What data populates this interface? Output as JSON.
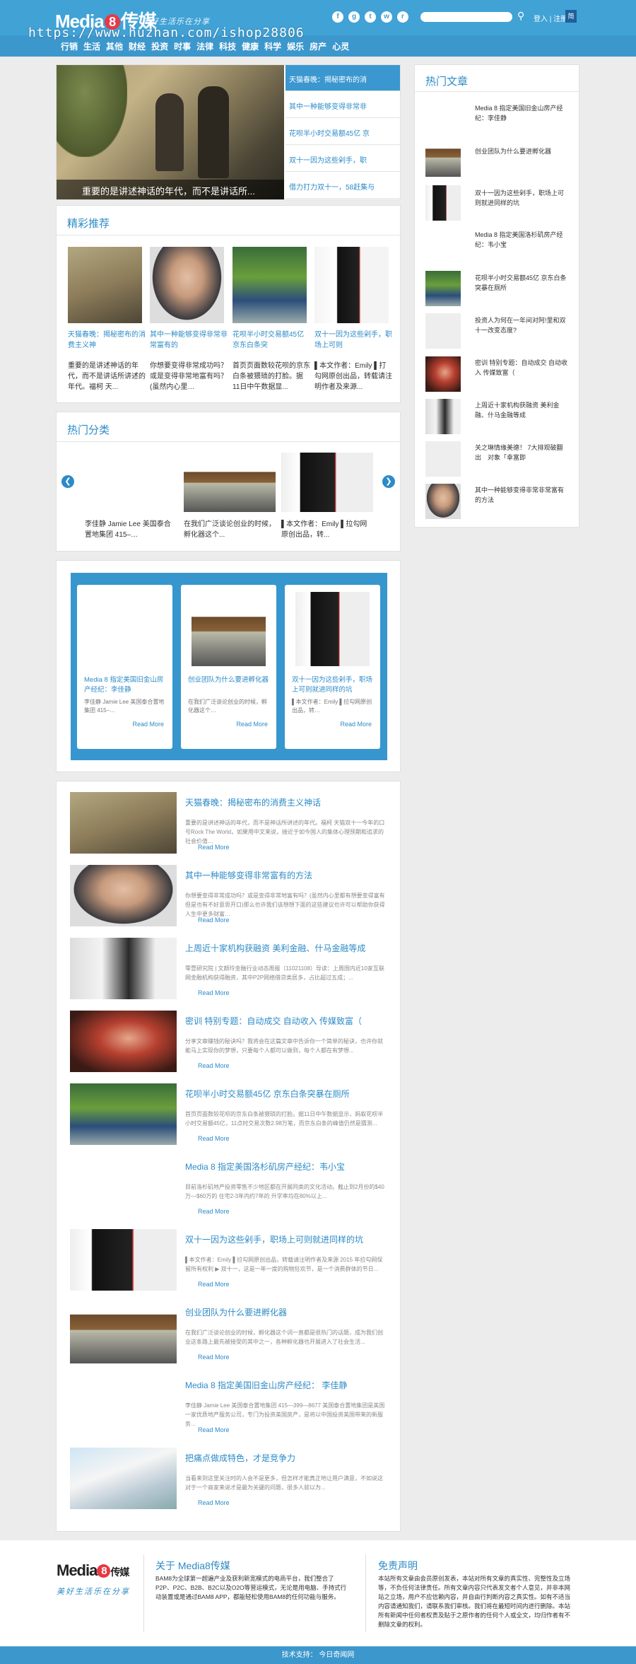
{
  "header": {
    "logo_text": "Media",
    "logo_num": "8",
    "logo_cn": "传媒",
    "slogan": "美好生活乐在分享",
    "watermark": "https://www.huzhan.com/ishop28806",
    "login": "登入 | 注册",
    "reg_btn": "简",
    "social_icons": [
      "facebook-icon",
      "google-plus-icon",
      "twitter-icon",
      "weibo-icon",
      "rss-icon"
    ],
    "nav": [
      "行销",
      "生活",
      "其他",
      "财经",
      "投资",
      "时事",
      "法律",
      "科技",
      "健康",
      "科学",
      "娱乐",
      "房产",
      "心灵"
    ]
  },
  "slider": {
    "caption": "重要的是讲述神话的年代，而不是讲话所...",
    "items": [
      "天猫春晚：揭秘密布的消",
      "其中一种能够变得非常非",
      "花呗半小时交易额45亿 京",
      "双十一因为这些剁手，职",
      "借力打力双十一，58赶集与"
    ]
  },
  "picks": {
    "title": "精彩推荐",
    "items": [
      {
        "title": "天猫春晚：揭秘密布的消费主义神",
        "desc": "重要的是讲述神话的年代，而不是讲话所讲述的年代。福柯 天..."
      },
      {
        "title": "其中一种能够变得非常非常富有的",
        "desc": "你想要变得非常成功吗？或是变得非常地富有吗？(虽然内心里…"
      },
      {
        "title": "花呗半小时交易额45亿 京东白条突",
        "desc": "首页页面数较花呗的京东白条被猥琐的打脸。据11日中午数据显..."
      },
      {
        "title": "双十一因为这些剁手，职场上可则",
        "desc": "▌本文作者：Emily ▌打勾网原创出品，转载请注明作者及来源..."
      }
    ]
  },
  "hot_cat": {
    "title": "热门分类",
    "prev": "❮",
    "next": "❯",
    "items": [
      {
        "title": "李佳静 Jamie Lee 美国泰合置地集团 415–…"
      },
      {
        "title": "在我们广泛谈论创业的时候，孵化器这个..."
      },
      {
        "title": "▌本文作者：Emily ▌拉勾网原创出品，转..."
      }
    ]
  },
  "cards": [
    {
      "title": "Media 8 指定美国旧金山房产经纪：李佳静",
      "desc": "李佳静 Jamie Lee 美国泰合置地集团 415–…",
      "more": "Read More"
    },
    {
      "title": "创业团队为什么要进孵化器",
      "desc": "在我们广泛谈论创业的时候，孵化器这个…",
      "more": "Read More"
    },
    {
      "title": "双十一因为这些剁手，职场上可则就进同样的坑",
      "desc": "▌本文作者：Emily ▌拉勾网原创出品，转…",
      "more": "Read More"
    }
  ],
  "articles": [
    {
      "title": "天猫春晚：揭秘密布的消费主义神话",
      "desc": "重要的是讲述神话的年代，而不是神话所讲述的年代。福柯 天猫双十一今年的口号Rock The World，如果用中文来说，接近于如今国人的集体心理预期和追求的社会价值…",
      "more": "Read More"
    },
    {
      "title": "其中一种能够变得非常富有的方法",
      "desc": "你想要变得非常成功吗？或是变得非常地富有吗？(虽然内心里都有想要变得富有但是也有不好意思开口)那么也许我们该想想下面的这些建议也许可以帮助你获得人生中更多财富…",
      "more": "Read More"
    },
    {
      "title": "上周近十家机构获融资 美利金融、什马金融等成",
      "desc": "零壹研究院 | 文颜玲金融行业动态周报（11021108）导读：上周国内近10家互联网金融机构获得融资，其中P2P网络借贷类居多，占比超过五成；...",
      "more": "Read More"
    },
    {
      "title": "密训 特别专题：自动成交 自动收入 传媒致富（",
      "desc": "分享文章赚钱的秘诀吗？我将会在这篇文章中告诉你一个简单的秘诀，也许你就能马上实现你的梦想，只要每个人都可以做到，每个人都在有梦想...",
      "more": "Read More"
    },
    {
      "title": "花呗半小时交易额45亿 京东白条突暴在厕所",
      "desc": "首页页面数较花呗的京东白条被猥琐的打脸。据11日中午数据显示，蚂蚁花呗半小时交易额45亿，11点时交易次数2.98万笔，而京东白条的峰值仍然是猜测...",
      "more": "Read More"
    },
    {
      "title": "Media 8 指定美国洛杉矶房产经纪：韦小宝",
      "desc": "目前洛杉矶地产投资零售不少地区都在开展同类的文化活动。截止到2月份的$40万—$60万的 住宅2-3年内约7年的 升学率均在80%以上...",
      "more": "Read More"
    },
    {
      "title": "双十一因为这些剁手，职场上可则就进同样的坑",
      "desc": "▌本文作者：Emily ▌拉勾网原创出品，转载请注明作者及来源 2015 年拉勾网保留所有权利 ▶ 双十一，这是一年一度的购物狂欢节，是一个消费群体的节日...",
      "more": "Read More"
    },
    {
      "title": "创业团队为什么要进孵化器",
      "desc": "在我们广泛谈论创业的时候，孵化器这个词一直都是很热门的话题，成为我们创业这条路上最先被接受的其中之一，各种孵化器也开展进入了社会生活...",
      "more": "Read More"
    },
    {
      "title": "Media 8 指定美国旧金山房产经纪： 李佳静",
      "desc": "李佳静 Jamie Lee 美国泰合置地集团 415—399—8677 美国泰合置地集团是美国一家优质地产服务公司，专门为投资美国房产，是将以中国投资美国带来的新服务...",
      "more": "Read More"
    },
    {
      "title": "把痛点做成特色，才是竞争力",
      "desc": "当看来到这里关注时的人会不是更多，但怎样才能真正地让用户满意，不如说这对于一个商家来说才是最为关键的问题，很多人就以为...",
      "more": "Read More"
    }
  ],
  "hot_articles": {
    "title": "热门文章",
    "items": [
      "Media 8 指定美国旧金山房产经纪：李佳静",
      "创业团队为什么要进孵化器",
      "双十一因为这些剁手，职场上可则就进同样的坑",
      "Media 8 指定美国洛杉矶房产经纪：韦小宝",
      "花呗半小时交易额45亿 京东白条突暴在厕所",
      "投资人为何在一年间对阿!里和双十一改变态度?",
      "密训 特别专题：自动成交 自动收入 传媒致富（",
      "上周近十家机构获融资 美利金融、什马金融等成",
      "关之琳情缘美德！ 7大排观破翻出　对象「幸富即",
      "其中一种能够变得非常非常富有的方法"
    ]
  },
  "footer": {
    "about_title": "关于 Media8传媒",
    "about_text": "BAM8为全球第一超遍产业及获利新宽模式的电商平台，我们整合了P2P、P2C、B2B、B2C以及O2O等营运模式，无论是用电脑、手持式行动装置或是通过BAM8 APP，都能轻松使用BAM8的任何功能与服务。",
    "disclaimer_title": "免责声明",
    "disclaimer_text": "本站所有文章由会员原创发表，本站对所有文章的真实性、完整性及立场等，不负任何法律责任。所有文章内容只代表发文者个人意见，并非本网站之立场，用户不应信赖内容，并自由行判断内容之真实性。如有不适当内容请通知我们，请联系我们审核。我们将在最短时间内进行删除。本站所有新闻中任何者权责及贴于之原作者的任何个人或全文，均归作者有不删除文章的权利。",
    "bottom_bar": "技术支持： 今日奇闻网"
  }
}
